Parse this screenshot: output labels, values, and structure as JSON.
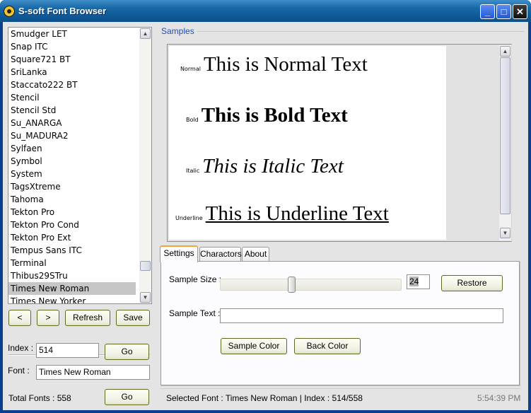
{
  "window": {
    "title": "S-soft Font Browser",
    "app_icon": "radiation-icon",
    "controls": {
      "minimize": "_",
      "maximize": "□",
      "close": "✕"
    }
  },
  "font_list": {
    "items": [
      "Smudger LET",
      "Snap ITC",
      "Square721 BT",
      "SriLanka",
      "Staccato222 BT",
      "Stencil",
      "Stencil Std",
      "Su_ANARGA",
      "Su_MADURA2",
      "Sylfaen",
      "Symbol",
      "System",
      "TagsXtreme",
      "Tahoma",
      "Tekton Pro",
      "Tekton Pro Cond",
      "Tekton Pro Ext",
      "Tempus Sans ITC",
      "Terminal",
      "Thibus29STru",
      "Times New Roman",
      "Times New Yorker"
    ],
    "selected_index": 20,
    "scroll_up": "▲",
    "scroll_down": "▼"
  },
  "nav": {
    "prev_label": "<",
    "next_label": ">",
    "refresh_label": "Refresh",
    "save_label": "Save"
  },
  "index_form": {
    "index_label": "Index :",
    "index_value": "514",
    "go_label": "Go",
    "font_label": "Font :",
    "font_value": "Times New Roman",
    "total_label": "Total Fonts : 558",
    "go2_label": "Go"
  },
  "samples": {
    "group_label": "Samples",
    "rows": [
      {
        "style_label": "Normal",
        "text": "This is Normal Text"
      },
      {
        "style_label": "Bold",
        "text": "This is Bold Text"
      },
      {
        "style_label": "Italic",
        "text": "This is Italic Text"
      },
      {
        "style_label": "Underline",
        "text": "This is Underline Text"
      }
    ]
  },
  "tabs": [
    {
      "label": "Settings",
      "active": true
    },
    {
      "label": "Charactors",
      "active": false
    },
    {
      "label": "About",
      "active": false
    }
  ],
  "settings": {
    "sample_size_label": "Sample Size :",
    "sample_size_value": "24",
    "slider_fraction": 0.39,
    "restore_label": "Restore",
    "sample_text_label": "Sample Text :",
    "sample_text_value": "",
    "sample_color_label": "Sample Color",
    "back_color_label": "Back Color"
  },
  "status": {
    "selected_font_text": "Selected Font : Times New Roman  |  Index : 514/558",
    "time": "5:54:39 PM"
  }
}
